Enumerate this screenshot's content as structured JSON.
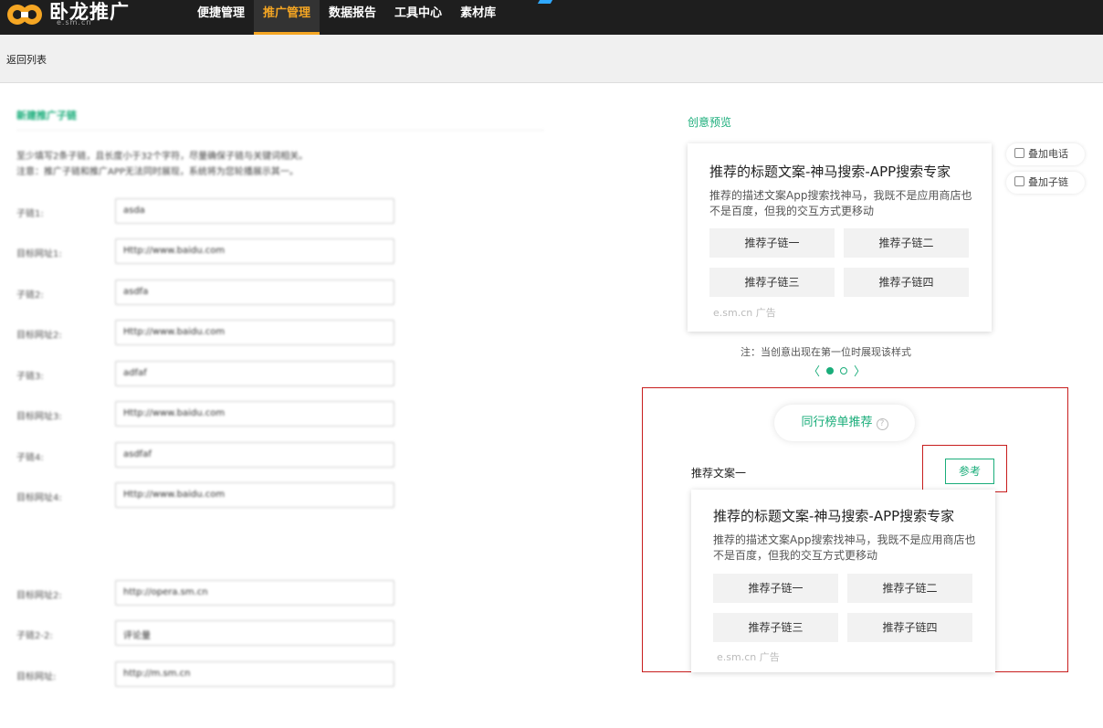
{
  "brand": {
    "name": "卧龙推广",
    "sub": "e.sm.cn"
  },
  "nav": [
    "便捷管理",
    "推广管理",
    "数据报告",
    "工具中心",
    "素材库"
  ],
  "subbar": {
    "back": "返回列表"
  },
  "left_form": {
    "title": "新建推广子链",
    "hint_lines": [
      "至少填写2条子链，且长度小于32个字符，尽量确保子链与关键词相关。",
      "注意：推广子链和推广APP无法同时展现，系统将为您轮播展示其一。"
    ],
    "rows": [
      {
        "label": "子链1:",
        "value": "asda"
      },
      {
        "label": "目标网址1:",
        "value": "Http://www.baidu.com"
      },
      {
        "label": "子链2:",
        "value": "asdfa"
      },
      {
        "label": "目标网址2:",
        "value": "Http://www.baidu.com"
      },
      {
        "label": "子链3:",
        "value": "adfaf"
      },
      {
        "label": "目标网址3:",
        "value": "Http://www.baidu.com"
      },
      {
        "label": "子链4:",
        "value": "asdfaf"
      },
      {
        "label": "目标网址4:",
        "value": "Http://www.baidu.com"
      },
      {
        "label": "目标网址2:",
        "value": "http://opera.sm.cn"
      },
      {
        "label": "子链2-2:",
        "value": "评论量"
      },
      {
        "label": "目标网址:",
        "value": "http://m.sm.cn"
      }
    ]
  },
  "preview": {
    "title": "创意预览",
    "card": {
      "title": "推荐的标题文案-神马搜索-APP搜索专家",
      "desc": "推荐的描述文案App搜索找神马，我既不是应用商店也不是百度，但我的交互方式更移动",
      "links": [
        "推荐子链一",
        "推荐子链二",
        "推荐子链三",
        "推荐子链四"
      ],
      "source": "e.sm.cn 广告"
    },
    "options": [
      "叠加电话",
      "叠加子链"
    ],
    "note": "注：当创意出现在第一位时展现该样式",
    "pager": {
      "prev": "〈",
      "next": "〉",
      "pages": 2,
      "current": 1
    }
  },
  "peer": {
    "pill_label": "同行榜单推荐",
    "help_icon": "?",
    "rec_label": "推荐文案一",
    "ref_button": "参考",
    "card": {
      "title": "推荐的标题文案-神马搜索-APP搜索专家",
      "desc": "推荐的描述文案App搜索找神马，我既不是应用商店也不是百度，但我的交互方式更移动",
      "links": [
        "推荐子链一",
        "推荐子链二",
        "推荐子链三",
        "推荐子链四"
      ],
      "source": "e.sm.cn 广告"
    }
  },
  "colors": {
    "accent": "#1aad7a",
    "nav_active": "#f5a623",
    "highlight": "#c81d1d"
  }
}
